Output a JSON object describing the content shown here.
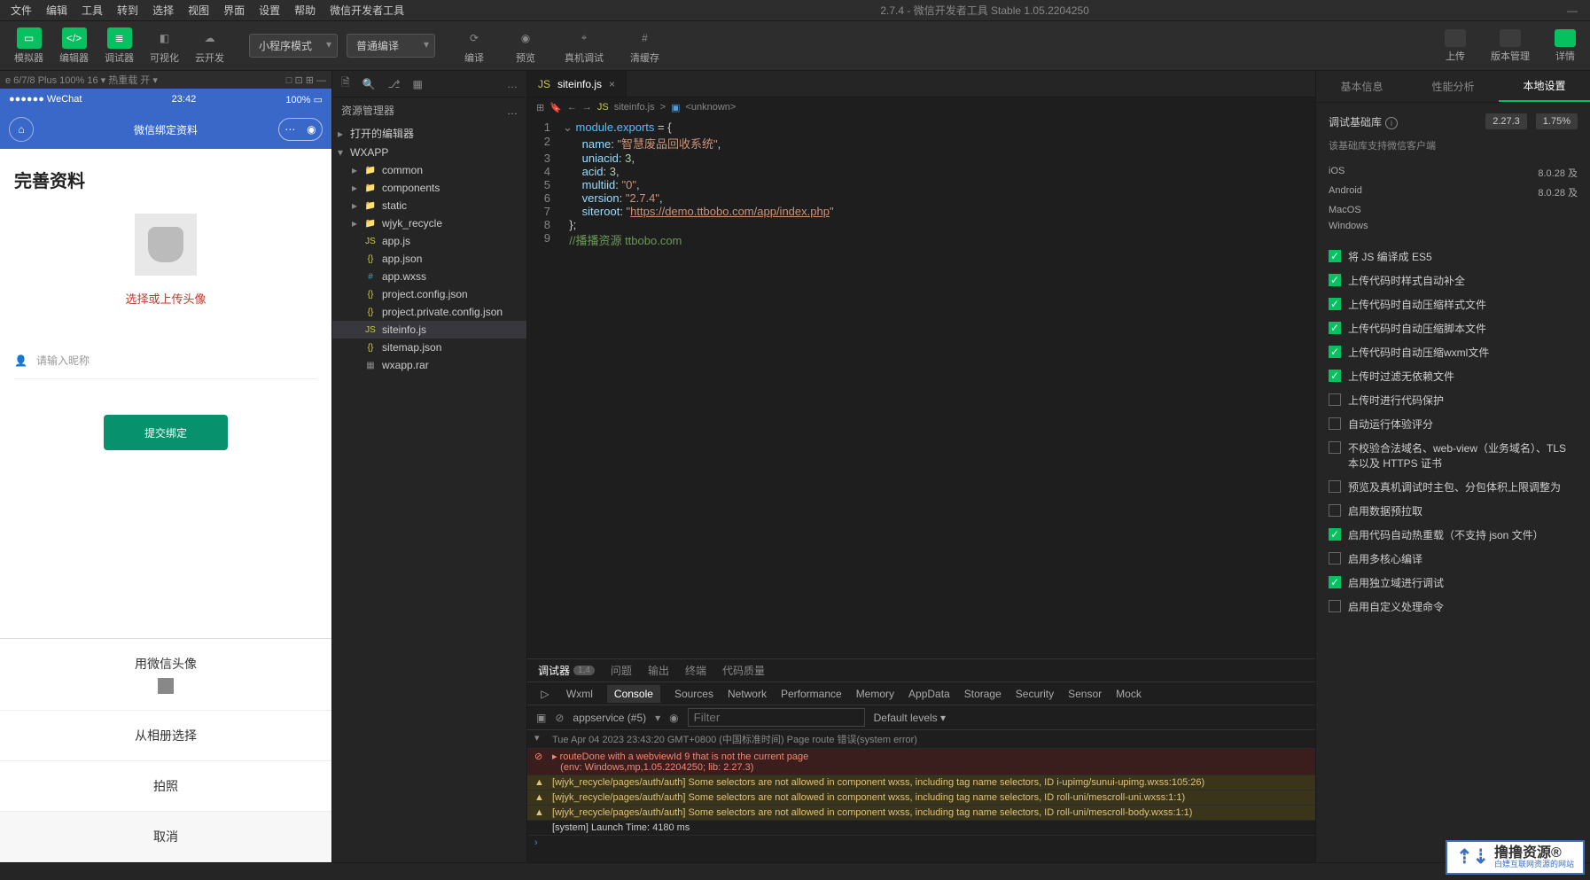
{
  "window": {
    "title": "2.7.4 - 微信开发者工具 Stable 1.05.2204250"
  },
  "menubar": [
    "文件",
    "编辑",
    "工具",
    "转到",
    "选择",
    "视图",
    "界面",
    "设置",
    "帮助",
    "微信开发者工具"
  ],
  "toolbar": {
    "sim": "模拟器",
    "editor": "编辑器",
    "debugger": "调试器",
    "visual": "可视化",
    "cloud": "云开发",
    "mode": "小程序模式",
    "compile": "普通编译",
    "compileBtn": "编译",
    "preview": "预览",
    "realdebug": "真机调试",
    "clearcache": "清缓存",
    "upload": "上传",
    "version": "版本管理",
    "detail": "详情"
  },
  "simstatus": "e 6/7/8 Plus 100% 16 ▾    热重载 开 ▾",
  "sim": {
    "carrier": "●●●●●● WeChat",
    "time": "23:42",
    "battery": "100%",
    "navtitle": "微信绑定资料",
    "heading": "完善资料",
    "avatarHint": "选择或上传头像",
    "nickPlaceholder": "请输入昵称",
    "submit": "提交绑定",
    "sheetTitle": "用微信头像",
    "sheetAlbum": "从相册选择",
    "sheetPhoto": "拍照",
    "sheetCancel": "取消"
  },
  "explorer": {
    "title": "资源管理器",
    "openEditors": "打开的编辑器",
    "root": "WXAPP",
    "items": [
      {
        "name": "common",
        "type": "folder"
      },
      {
        "name": "components",
        "type": "folder"
      },
      {
        "name": "static",
        "type": "folder"
      },
      {
        "name": "wjyk_recycle",
        "type": "folder"
      },
      {
        "name": "app.js",
        "type": "js"
      },
      {
        "name": "app.json",
        "type": "json"
      },
      {
        "name": "app.wxss",
        "type": "css"
      },
      {
        "name": "project.config.json",
        "type": "json"
      },
      {
        "name": "project.private.config.json",
        "type": "json"
      },
      {
        "name": "siteinfo.js",
        "type": "js",
        "sel": true
      },
      {
        "name": "sitemap.json",
        "type": "json"
      },
      {
        "name": "wxapp.rar",
        "type": "rar"
      }
    ]
  },
  "editor": {
    "tab": "siteinfo.js",
    "crumb_file": "siteinfo.js",
    "crumb_sym": "<unknown>",
    "code": [
      {
        "n": 1,
        "html": "<span class='tk-prop'>module</span>.<span class='tk-prop'>exports</span> = {"
      },
      {
        "n": 2,
        "html": "    <span class='tk-key'>name</span>: <span class='tk-str'>\"智慧废品回收系统\"</span>,"
      },
      {
        "n": 3,
        "html": "    <span class='tk-key'>uniacid</span>: <span class='tk-num'>3</span>,"
      },
      {
        "n": 4,
        "html": "    <span class='tk-key'>acid</span>: <span class='tk-num'>3</span>,"
      },
      {
        "n": 5,
        "html": "    <span class='tk-key'>multiid</span>: <span class='tk-str'>\"0\"</span>,"
      },
      {
        "n": 6,
        "html": "    <span class='tk-key'>version</span>: <span class='tk-str'>\"2.7.4\"</span>,"
      },
      {
        "n": 7,
        "html": "    <span class='tk-key'>siteroot</span>: <span class='tk-str'>\"</span><span class='tk-url'>https://demo.ttbobo.com/app/index.php</span><span class='tk-str'>\"</span>"
      },
      {
        "n": 8,
        "html": "};"
      },
      {
        "n": 9,
        "html": "<span class='tk-cmt'>//播播资源 ttbobo.com</span>"
      }
    ]
  },
  "debugger": {
    "tabs1": [
      "调试器",
      "1,4",
      "问题",
      "输出",
      "终端",
      "代码质量"
    ],
    "tabs2": [
      "Wxml",
      "Console",
      "Sources",
      "Network",
      "Performance",
      "Memory",
      "AppData",
      "Storage",
      "Security",
      "Sensor",
      "Mock"
    ],
    "scope": "appservice (#5)",
    "filterPH": "Filter",
    "levels": "Default levels ▾",
    "lines": [
      {
        "cls": "greyline",
        "sym": "▾",
        "txt": "Tue Apr 04 2023 23:43:20 GMT+0800 (中国标准时间) Page route 错误(system error)"
      },
      {
        "cls": "err",
        "sym": "⊘",
        "txt": "▸ routeDone with a webviewId 9 that is not the current page\n   (env: Windows,mp,1.05.2204250; lib: 2.27.3)"
      },
      {
        "cls": "warn",
        "sym": "▲",
        "txt": "[wjyk_recycle/pages/auth/auth] Some selectors are not allowed in component wxss, including tag name selectors, ID i-upimg/sunui-upimg.wxss:105:26)"
      },
      {
        "cls": "warn",
        "sym": "▲",
        "txt": "[wjyk_recycle/pages/auth/auth] Some selectors are not allowed in component wxss, including tag name selectors, ID roll-uni/mescroll-uni.wxss:1:1)"
      },
      {
        "cls": "warn",
        "sym": "▲",
        "txt": "[wjyk_recycle/pages/auth/auth] Some selectors are not allowed in component wxss, including tag name selectors, ID roll-uni/mescroll-body.wxss:1:1)"
      },
      {
        "cls": "info",
        "sym": "",
        "txt": "[system] Launch Time: 4180 ms"
      }
    ]
  },
  "rightpanel": {
    "tabs": [
      "基本信息",
      "性能分析",
      "本地设置"
    ],
    "libLabel": "调试基础库",
    "libVer": "2.27.3",
    "libPct": "1.75%",
    "libNote": "该基础库支持微信客户端",
    "platforms": [
      {
        "name": "iOS",
        "ver": "8.0.28 及"
      },
      {
        "name": "Android",
        "ver": "8.0.28 及"
      },
      {
        "name": "MacOS",
        "ver": ""
      },
      {
        "name": "Windows",
        "ver": ""
      }
    ],
    "checks": [
      {
        "on": true,
        "label": "将 JS 编译成 ES5"
      },
      {
        "on": true,
        "label": "上传代码时样式自动补全"
      },
      {
        "on": true,
        "label": "上传代码时自动压缩样式文件"
      },
      {
        "on": true,
        "label": "上传代码时自动压缩脚本文件"
      },
      {
        "on": true,
        "label": "上传代码时自动压缩wxml文件"
      },
      {
        "on": true,
        "label": "上传时过滤无依赖文件"
      },
      {
        "on": false,
        "label": "上传时进行代码保护"
      },
      {
        "on": false,
        "label": "自动运行体验评分"
      },
      {
        "on": false,
        "label": "不校验合法域名、web-view（业务域名）、TLS 本以及 HTTPS 证书"
      },
      {
        "on": false,
        "label": "预览及真机调试时主包、分包体积上限调整为"
      },
      {
        "on": false,
        "label": "启用数据预拉取"
      },
      {
        "on": true,
        "label": "启用代码自动热重载（不支持 json 文件）"
      },
      {
        "on": false,
        "label": "启用多核心编译"
      },
      {
        "on": true,
        "label": "启用独立域进行调试"
      },
      {
        "on": false,
        "label": "启用自定义处理命令"
      }
    ]
  },
  "watermark": {
    "big": "撸撸资源®",
    "sm": "白嫖互联网资源的网站"
  }
}
